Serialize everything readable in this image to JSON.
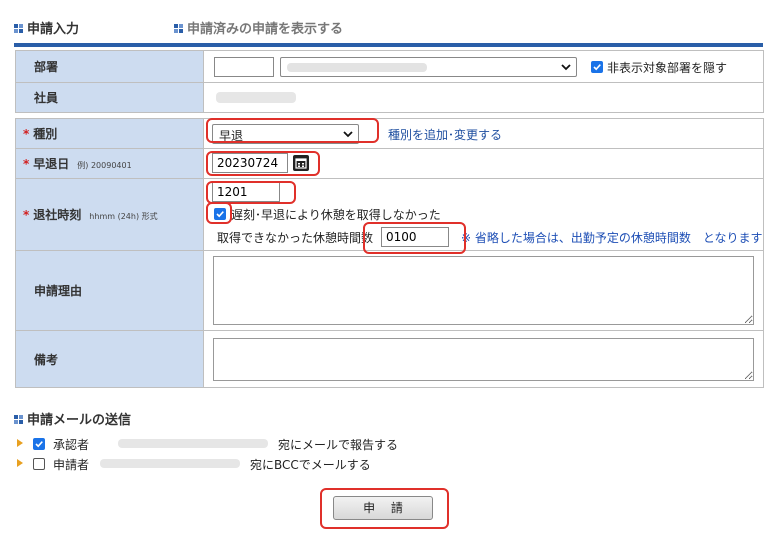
{
  "tabs": {
    "active": "申請入力",
    "other": "申請済みの申請を表示する"
  },
  "form": {
    "department": {
      "label": "部署",
      "hide_label": "非表示対象部署を隠す",
      "hide_checked": true
    },
    "employee": {
      "label": "社員"
    },
    "type": {
      "label": "種別",
      "value": "早退",
      "add_link": "種別を追加･変更する"
    },
    "date": {
      "label": "早退日",
      "example": "例) 20090401",
      "value": "20230724"
    },
    "leave_time": {
      "label": "退社時刻",
      "format": "hhmm (24h) 形式",
      "value": "1201",
      "no_break_label": "遅刻･早退により休憩を取得しなかった",
      "no_break_checked": true,
      "break_label": "取得できなかった休憩時間数",
      "break_value": "0100",
      "break_note": "※ 省略した場合は、出勤予定の休憩時間数　となります"
    },
    "reason": {
      "label": "申請理由"
    },
    "remarks": {
      "label": "備考"
    }
  },
  "mail": {
    "title": "申請メールの送信",
    "approver": {
      "label": "承認者",
      "suffix": "宛にメールで報告する",
      "checked": true
    },
    "applicant": {
      "label": "申請者",
      "suffix": "宛にBCCでメールする",
      "checked": false
    }
  },
  "submit_label": "申 請",
  "required_mark": "*",
  "colors": {
    "accent": "#2a5ea8",
    "label_bg": "#cddcf0",
    "highlight": "#e0302a",
    "required": "#d21f1f"
  }
}
